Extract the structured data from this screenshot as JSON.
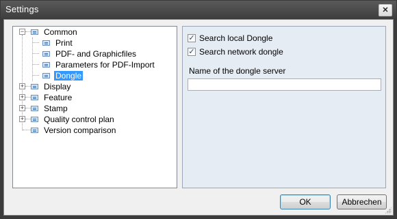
{
  "window": {
    "title": "Settings"
  },
  "tree": {
    "nodes": [
      {
        "label": "Common",
        "expander": "−"
      },
      {
        "label": "Print"
      },
      {
        "label": "PDF- and Graphicfiles"
      },
      {
        "label": "Parameters for PDF-Import"
      },
      {
        "label": "Dongle",
        "selected": true
      },
      {
        "label": "Display",
        "expander": "+"
      },
      {
        "label": "Feature",
        "expander": "+"
      },
      {
        "label": "Stamp",
        "expander": "+"
      },
      {
        "label": "Quality control plan",
        "expander": "+"
      },
      {
        "label": "Version comparison"
      }
    ]
  },
  "panel": {
    "search_local": {
      "label": "Search local Dongle",
      "checked": true
    },
    "search_network": {
      "label": "Search network dongle",
      "checked": true
    },
    "server_label": "Name of the dongle server",
    "server_value": ""
  },
  "buttons": {
    "ok": "OK",
    "cancel": "Abbrechen"
  },
  "icons": {
    "close": "close-icon",
    "node": "page-icon",
    "check": "✓"
  }
}
